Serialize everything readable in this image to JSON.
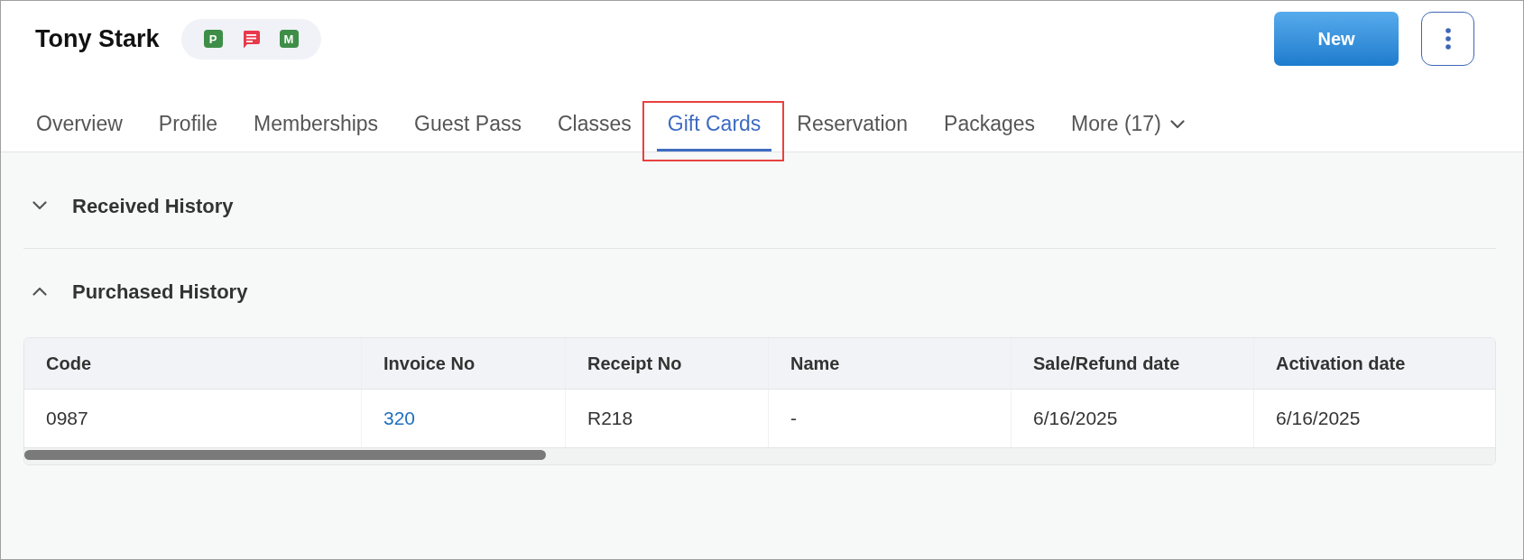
{
  "header": {
    "name": "Tony Stark",
    "badges": [
      {
        "kind": "letter",
        "text": "P",
        "color": "#3e8e47"
      },
      {
        "kind": "chat",
        "color": "#e8394a"
      },
      {
        "kind": "letter",
        "text": "M",
        "color": "#3e8e47"
      }
    ],
    "new_button": {
      "label": "New"
    }
  },
  "tabs": [
    {
      "label": "Overview",
      "kind": "tab",
      "selected": false,
      "highlighted": false
    },
    {
      "label": "Profile",
      "kind": "tab",
      "selected": false,
      "highlighted": false
    },
    {
      "label": "Memberships",
      "kind": "tab",
      "selected": false,
      "highlighted": false
    },
    {
      "label": "Guest Pass",
      "kind": "tab",
      "selected": false,
      "highlighted": false
    },
    {
      "label": "Classes",
      "kind": "tab",
      "selected": false,
      "highlighted": false
    },
    {
      "label": "Gift Cards",
      "kind": "tab",
      "selected": true,
      "highlighted": true
    },
    {
      "label": "Reservation",
      "kind": "tab",
      "selected": false,
      "highlighted": false
    },
    {
      "label": "Packages",
      "kind": "tab",
      "selected": false,
      "highlighted": false
    },
    {
      "label": "More (17)",
      "kind": "menu",
      "selected": false,
      "highlighted": false
    }
  ],
  "sections": [
    {
      "title": "Received History",
      "expanded": false
    },
    {
      "title": "Purchased History",
      "expanded": true,
      "table": {
        "columns": [
          {
            "label": "Code",
            "kind": "text"
          },
          {
            "label": "Invoice No",
            "kind": "link"
          },
          {
            "label": "Receipt No",
            "kind": "text"
          },
          {
            "label": "Name",
            "kind": "text"
          },
          {
            "label": "Sale/Refund date",
            "kind": "text"
          },
          {
            "label": "Activation date",
            "kind": "text"
          }
        ],
        "rows": [
          [
            "0987",
            "320",
            "R218",
            "-",
            "6/16/2025",
            "6/16/2025"
          ]
        ]
      }
    }
  ]
}
